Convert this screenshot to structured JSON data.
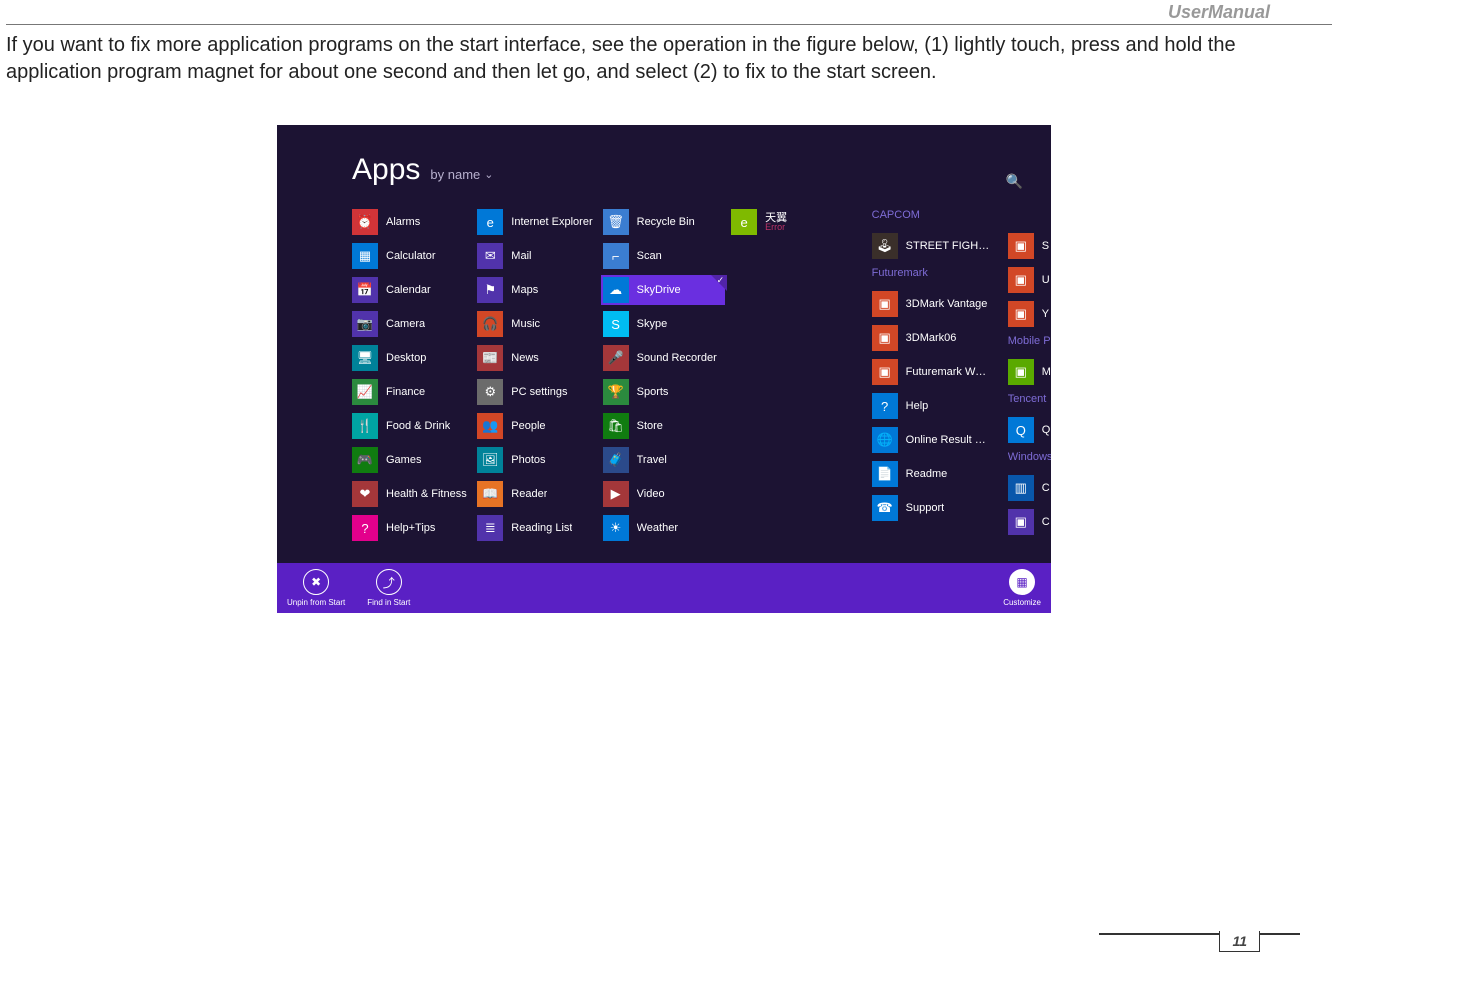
{
  "doc": {
    "header": "UserManual",
    "instruction": "If you want to fix more application programs on the start interface, see the operation in the figure below, (1) lightly touch, press and hold the application program magnet for about one second and then let go, and select (2) to fix to the start screen.",
    "page_number": "11"
  },
  "apps_screen": {
    "title": "Apps",
    "sort_label": "by name",
    "search_glyph": "🔍",
    "columns": {
      "c1": [
        {
          "name": "Alarms",
          "color": "tc-red",
          "glyph": "⏰"
        },
        {
          "name": "Calculator",
          "color": "tc-blue",
          "glyph": "▦"
        },
        {
          "name": "Calendar",
          "color": "tc-purple",
          "glyph": "📅"
        },
        {
          "name": "Camera",
          "color": "tc-purple",
          "glyph": "📷"
        },
        {
          "name": "Desktop",
          "color": "tc-teal",
          "glyph": "🖥"
        },
        {
          "name": "Finance",
          "color": "tc-green2",
          "glyph": "📈"
        },
        {
          "name": "Food & Drink",
          "color": "tc-teal2",
          "glyph": "🍴"
        },
        {
          "name": "Games",
          "color": "tc-green",
          "glyph": "🎮"
        },
        {
          "name": "Health & Fitness",
          "color": "tc-maroon",
          "glyph": "❤"
        },
        {
          "name": "Help+Tips",
          "color": "tc-pink",
          "glyph": "?"
        }
      ],
      "c2": [
        {
          "name": "Internet Explorer",
          "color": "tc-blue",
          "glyph": "e"
        },
        {
          "name": "Mail",
          "color": "tc-purple",
          "glyph": "✉"
        },
        {
          "name": "Maps",
          "color": "tc-purple",
          "glyph": "⚑"
        },
        {
          "name": "Music",
          "color": "tc-orange",
          "glyph": "🎧"
        },
        {
          "name": "News",
          "color": "tc-maroon",
          "glyph": "📰"
        },
        {
          "name": "PC settings",
          "color": "tc-grey",
          "glyph": "⚙"
        },
        {
          "name": "People",
          "color": "tc-orange",
          "glyph": "👥"
        },
        {
          "name": "Photos",
          "color": "tc-teal",
          "glyph": "🖼"
        },
        {
          "name": "Reader",
          "color": "tc-orange2",
          "glyph": "📖"
        },
        {
          "name": "Reading List",
          "color": "tc-purple",
          "glyph": "≣"
        }
      ],
      "c3": [
        {
          "name": "Recycle Bin",
          "color": "tc-blue2",
          "glyph": "🗑"
        },
        {
          "name": "Scan",
          "color": "tc-blue2",
          "glyph": "⌐"
        },
        {
          "name": "SkyDrive",
          "color": "tc-blue",
          "glyph": "☁",
          "selected": true
        },
        {
          "name": "Skype",
          "color": "tc-cyan",
          "glyph": "S"
        },
        {
          "name": "Sound Recorder",
          "color": "tc-maroon",
          "glyph": "🎤"
        },
        {
          "name": "Sports",
          "color": "tc-green2",
          "glyph": "🏆"
        },
        {
          "name": "Store",
          "color": "tc-green",
          "glyph": "🛍"
        },
        {
          "name": "Travel",
          "color": "tc-navy",
          "glyph": "🧳"
        },
        {
          "name": "Video",
          "color": "tc-maroon",
          "glyph": "▶"
        },
        {
          "name": "Weather",
          "color": "tc-blue",
          "glyph": "☀"
        }
      ],
      "c4": [
        {
          "name": "天翼",
          "sub": "Error",
          "color": "tc-lime",
          "glyph": "e"
        }
      ],
      "c5_groups": [
        {
          "label": "CAPCOM",
          "items": [
            {
              "name": "STREET FIGHTER IV BENCHMARK",
              "color": "tc-sf",
              "glyph": "🕹"
            }
          ]
        },
        {
          "label": "Futuremark",
          "items": [
            {
              "name": "3DMark Vantage",
              "color": "tc-orange",
              "glyph": "▣"
            },
            {
              "name": "3DMark06",
              "color": "tc-orange",
              "glyph": "▣"
            },
            {
              "name": "Futuremark Website",
              "color": "tc-orange",
              "glyph": "▣"
            },
            {
              "name": "Help",
              "color": "tc-blue",
              "glyph": "?"
            },
            {
              "name": "Online Result Browser",
              "color": "tc-blue",
              "glyph": "🌐"
            },
            {
              "name": "Readme",
              "color": "tc-blue",
              "glyph": "📄"
            },
            {
              "name": "Support",
              "color": "tc-blue",
              "glyph": "☎"
            }
          ]
        }
      ],
      "c6_groups": [
        {
          "label": "",
          "items": [
            {
              "name": "S",
              "color": "tc-orange",
              "glyph": "▣"
            },
            {
              "name": "U",
              "color": "tc-orange",
              "glyph": "▣"
            },
            {
              "name": "Y",
              "color": "tc-orange",
              "glyph": "▣"
            }
          ]
        },
        {
          "label": "Mobile P",
          "items": [
            {
              "name": "M",
              "color": "tc-green3",
              "glyph": "▣"
            }
          ]
        },
        {
          "label": "Tencent",
          "items": [
            {
              "name": "Q",
              "color": "tc-blue",
              "glyph": "Q"
            }
          ]
        },
        {
          "label": "Windows",
          "items": [
            {
              "name": "C",
              "color": "tc-win",
              "glyph": "▥"
            },
            {
              "name": "C",
              "color": "tc-purple",
              "glyph": "▣"
            }
          ]
        }
      ]
    },
    "appbar": {
      "unpin": "Unpin from Start",
      "find": "Find in Start",
      "customize": "Customize"
    }
  }
}
